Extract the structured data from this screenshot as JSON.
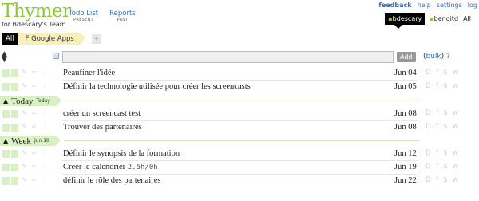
{
  "logo": {
    "word": "Thymer",
    "subtitle": "for Bdescary's Team"
  },
  "nav": [
    {
      "label": "Todo List",
      "sub": "PRESENT"
    },
    {
      "label": "Reports",
      "sub": "PAST"
    }
  ],
  "toplinks": {
    "feedback": "feedback",
    "help": "help",
    "settings": "settings",
    "logout": "log"
  },
  "users": {
    "active": "bdescary",
    "second": "benoitd",
    "all": "All"
  },
  "tabs": {
    "all": "All",
    "project": "F Google Apps",
    "add": "+"
  },
  "input": {
    "value": "",
    "add_label": "Add",
    "bulk_open": "(",
    "bulk_label": "bulk",
    "bulk_close": ")",
    "help": "?"
  },
  "actions": {
    "d": "D",
    "f": "f",
    "s": "$",
    "w": "w"
  },
  "sections": [
    {
      "name": "",
      "sub": "",
      "tasks": [
        {
          "title": "Peaufiner l'idée",
          "extra": "",
          "date": "Jun 04"
        },
        {
          "title": "Définir la technologie utilisée pour créer les screencasts",
          "extra": "",
          "date": "Jun 05"
        }
      ]
    },
    {
      "name": "Today",
      "sub": "Today",
      "tasks": [
        {
          "title": "créer un screencast test",
          "extra": "",
          "date": "Jun 08"
        },
        {
          "title": "Trouver des partenaires",
          "extra": "",
          "date": "Jun 08"
        }
      ]
    },
    {
      "name": "Week",
      "sub": "Jun 10",
      "tasks": [
        {
          "title": "Définir le synopsis de la formation",
          "extra": "",
          "date": "Jun 12"
        },
        {
          "title": "Créer le calendrier ",
          "extra": "2.5h/0h",
          "date": "Jun 19"
        },
        {
          "title": "définir le rôle des partenaires",
          "extra": "",
          "date": "Jun 22"
        }
      ]
    }
  ],
  "colors": {
    "accent": "#8cc63f",
    "link": "#3a6fb0",
    "divider": "#d9f0c4",
    "tab_project": "#f7f0b8"
  }
}
